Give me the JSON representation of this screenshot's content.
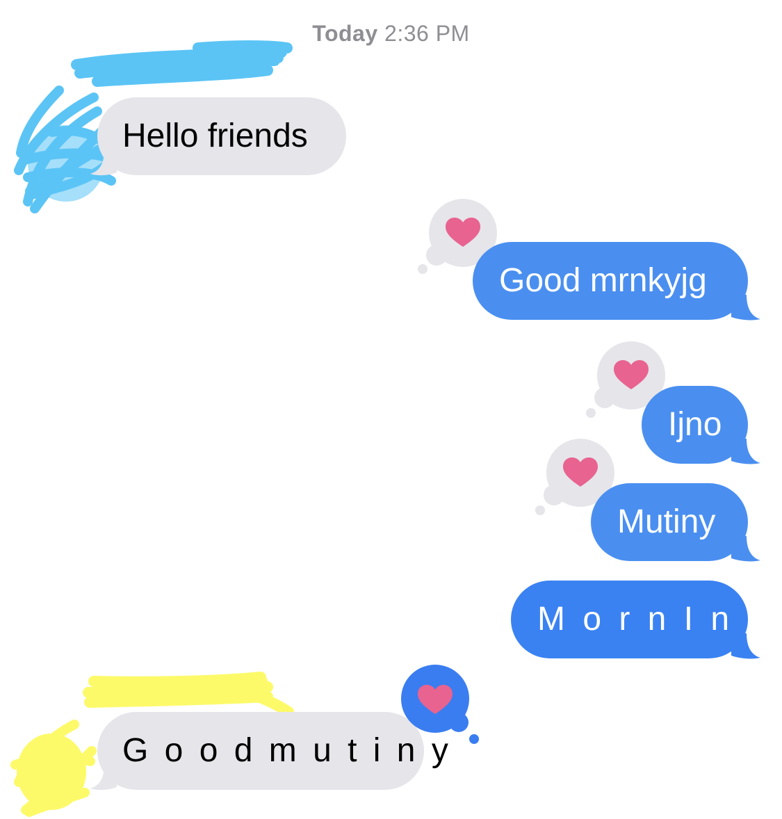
{
  "header": {
    "day": "Today",
    "time": "2:36 PM"
  },
  "messages": [
    {
      "id": "msg-1",
      "direction": "incoming",
      "text": "Hello friends",
      "reaction": null
    },
    {
      "id": "msg-2",
      "direction": "outgoing",
      "text": "Good mrnkyjg",
      "reaction": "heart"
    },
    {
      "id": "msg-3",
      "direction": "outgoing",
      "text": "Ijno",
      "reaction": "heart"
    },
    {
      "id": "msg-4",
      "direction": "outgoing",
      "text": "Mutiny",
      "reaction": "heart"
    },
    {
      "id": "msg-5",
      "direction": "outgoing",
      "text": "M o r n I n g",
      "reaction": null
    },
    {
      "id": "msg-6",
      "direction": "incoming",
      "text": "G o o d m u t i n y",
      "reaction": "heart",
      "reaction_by": "me"
    }
  ],
  "colors": {
    "incoming_bubble": "#e5e5ea",
    "outgoing_bubble": "#4a8ff0",
    "reaction_heart": "#e8638f",
    "reaction_bg_other": "#e5e5ea",
    "reaction_bg_me": "#3a7df0",
    "redaction_blue": "#5bc4f5",
    "redaction_yellow": "#fdfa6a",
    "timestamp": "#8e8e93"
  },
  "icons": {
    "reaction": "heart-icon"
  }
}
